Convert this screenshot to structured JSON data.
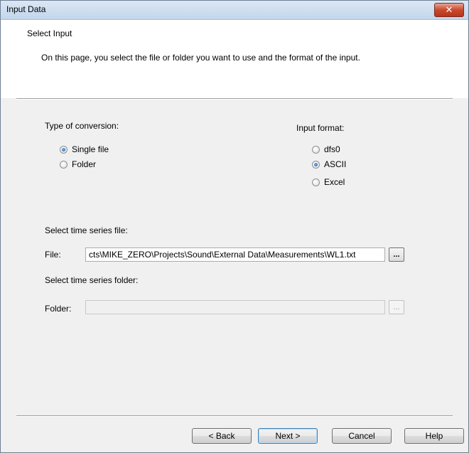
{
  "window": {
    "title": "Input Data",
    "close_glyph": "✕"
  },
  "header": {
    "title": "Select Input",
    "description": "On this page,  you select the file or folder you want to use and the format of the input."
  },
  "conversion": {
    "label": "Type of conversion:",
    "options": [
      {
        "label": "Single file",
        "checked": true
      },
      {
        "label": "Folder",
        "checked": false
      }
    ]
  },
  "input_format": {
    "label": "Input format:",
    "options": [
      {
        "label": "dfs0",
        "checked": false
      },
      {
        "label": "ASCII",
        "checked": true
      },
      {
        "label": "Excel",
        "checked": false
      }
    ]
  },
  "file_section": {
    "heading": "Select time series file:",
    "field_label": "File:",
    "value": "cts\\MIKE_ZERO\\Projects\\Sound\\External Data\\Measurements\\WL1.txt",
    "browse_label": "..."
  },
  "folder_section": {
    "heading": "Select time series folder:",
    "field_label": "Folder:",
    "value": "",
    "browse_label": "..."
  },
  "buttons": {
    "back": "< Back",
    "next": "Next >",
    "cancel": "Cancel",
    "help": "Help"
  }
}
